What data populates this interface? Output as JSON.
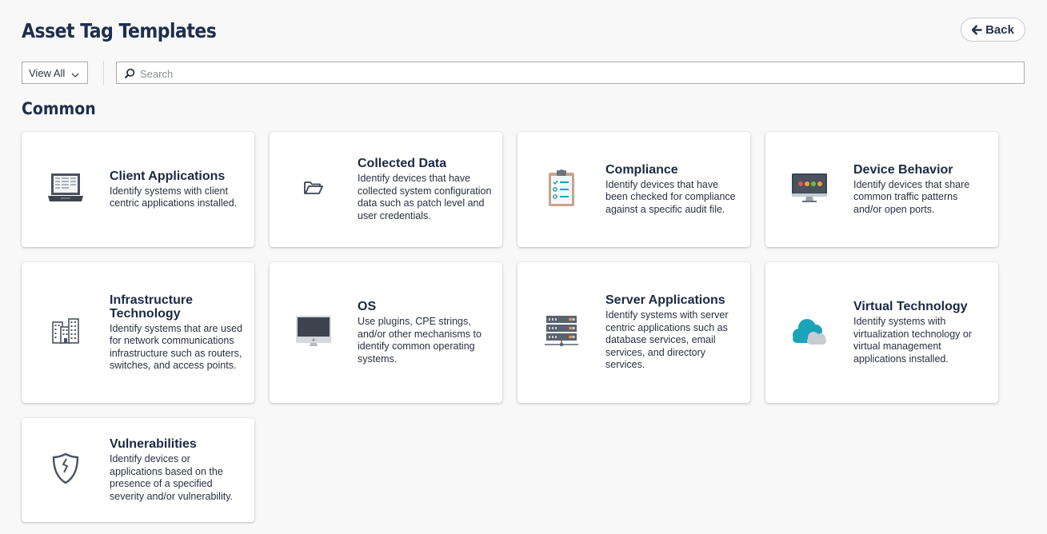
{
  "header": {
    "title": "Asset Tag Templates",
    "back_label": "Back"
  },
  "toolbar": {
    "filter_value": "View All",
    "search_placeholder": "Search"
  },
  "section": {
    "title": "Common"
  },
  "cards": [
    {
      "title": "Client Applications",
      "desc": "Identify systems with client centric applications installed.",
      "icon": "laptop-icon"
    },
    {
      "title": "Collected Data",
      "desc": "Identify devices that have collected system configuration data such as patch level and user credentials.",
      "icon": "folder-icon"
    },
    {
      "title": "Compliance",
      "desc": "Identify devices that have been checked for compliance against a specific audit file.",
      "icon": "clipboard-checklist-icon"
    },
    {
      "title": "Device Behavior",
      "desc": "Identify devices that share common traffic patterns and/or open ports.",
      "icon": "monitor-dots-icon"
    },
    {
      "title": "Infrastructure Technology",
      "desc": "Identify systems that are used for network communications infrastructure such as routers, switches, and access points.",
      "icon": "buildings-icon"
    },
    {
      "title": "OS",
      "desc": "Use plugins, CPE strings, and/or other mechanisms to identify common operating systems.",
      "icon": "desktop-monitor-icon"
    },
    {
      "title": "Server Applications",
      "desc": "Identify systems with server centric applications such as database services, email services, and directory services.",
      "icon": "server-rack-icon"
    },
    {
      "title": "Virtual Technology",
      "desc": "Identify systems with virtualization technology or virtual management applications installed.",
      "icon": "cloud-icon"
    },
    {
      "title": "Vulnerabilities",
      "desc": "Identify devices or applications based on the presence of a specified severity and/or vulnerability.",
      "icon": "broken-shield-icon"
    }
  ],
  "colors": {
    "background": "#f8f8f8",
    "title": "#1e2f4d",
    "card": "#ffffff",
    "cloud": "#1ba3b8"
  }
}
